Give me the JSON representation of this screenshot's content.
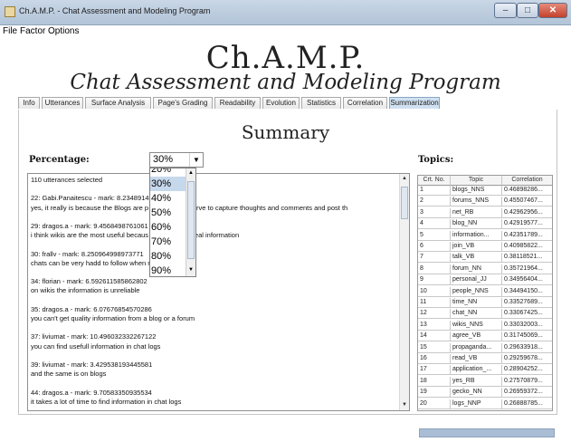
{
  "window": {
    "title": "Ch.A.M.P. - Chat Assessment and Modeling Program"
  },
  "menu": {
    "items": [
      "File",
      "Factor",
      "Options"
    ]
  },
  "banner": {
    "title": "Ch.A.M.P.",
    "subtitle": "Chat Assessment and Modeling Program"
  },
  "tabs": [
    {
      "label": "Info",
      "active": false
    },
    {
      "label": "Utterances",
      "active": false
    },
    {
      "label": "Surface Analysis",
      "active": false
    },
    {
      "label": "Page's Grading",
      "active": false
    },
    {
      "label": "Readability",
      "active": false
    },
    {
      "label": "Evolution",
      "active": false
    },
    {
      "label": "Statistics",
      "active": false
    },
    {
      "label": "Correlation",
      "active": false
    },
    {
      "label": "Summarization",
      "active": true
    }
  ],
  "summary": {
    "title": "Summary",
    "percentage_label": "Percentage:",
    "percentage_value": "30%",
    "percentage_options": [
      "20%",
      "30%",
      "40%",
      "50%",
      "60%",
      "70%",
      "80%",
      "90%"
    ],
    "selected_option_index": 1,
    "text_lines": [
      "110 utterances selected",
      "",
      "22: Gabi.Panaitescu - mark: 8.2348914",
      "yes, it really is because the Blogs are p                               journals that serve to capture thoughts and comments and post th",
      "",
      "29: dragos.a - mark: 9.4568498761061",
      "i think wikis are the most useful becaus                              objective and real information",
      "",
      "30: frallv - mark: 8.250964998973771",
      "chats can be very hadd to follow when n                              e talking",
      "",
      "34: florian - mark: 6.592611585862802",
      "on wikis the information is unreliable",
      "",
      "35: dragos.a - mark: 6.07676854570286",
      "you can't get quality information from a blog or a forum",
      "",
      "37: liviumat - mark: 10.496032332267122",
      "you can find usefull information in chat logs",
      "",
      "39: liviumat - mark: 3.429538193445581",
      "and the same is on blogs",
      "",
      "44: dragos.a - mark: 9.70583350935534",
      "it takes a lot of time to find information in chat logs"
    ]
  },
  "topics": {
    "label": "Topics:",
    "headers": [
      "Crt. No.",
      "Topic",
      "Correlation"
    ],
    "rows": [
      [
        "1",
        "blogs_NNS",
        "0.46898286..."
      ],
      [
        "2",
        "forums_NNS",
        "0.45507467..."
      ],
      [
        "3",
        "net_RB",
        "0.42962956..."
      ],
      [
        "4",
        "blog_NN",
        "0.42919577..."
      ],
      [
        "5",
        "information...",
        "0.42351789..."
      ],
      [
        "6",
        "join_VB",
        "0.40985822..."
      ],
      [
        "7",
        "talk_VB",
        "0.38118521..."
      ],
      [
        "8",
        "forum_NN",
        "0.35721964..."
      ],
      [
        "9",
        "personal_JJ",
        "0.34956404..."
      ],
      [
        "10",
        "people_NNS",
        "0.34494150..."
      ],
      [
        "11",
        "time_NN",
        "0.33527689..."
      ],
      [
        "12",
        "chat_NN",
        "0.33067425..."
      ],
      [
        "13",
        "wikis_NNS",
        "0.33032003..."
      ],
      [
        "14",
        "agree_VB",
        "0.31745069..."
      ],
      [
        "15",
        "propaganda...",
        "0.29633918..."
      ],
      [
        "16",
        "read_VB",
        "0.29259678..."
      ],
      [
        "17",
        "application_...",
        "0.28904252..."
      ],
      [
        "18",
        "yes_RB",
        "0.27570879..."
      ],
      [
        "19",
        "gecko_NN",
        "0.26959372..."
      ],
      [
        "20",
        "logs_NNP",
        "0.26888785..."
      ]
    ]
  }
}
